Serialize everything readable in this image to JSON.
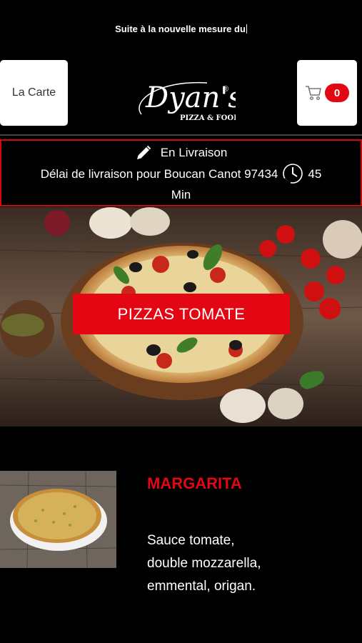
{
  "ticker": {
    "text": "Suite à la nouvelle mesure du"
  },
  "header": {
    "menu_label": "La Carte",
    "cart_count": "0",
    "logo": {
      "name": "Dyan's",
      "tagline": "PIZZA & FOOD",
      "mark": "®"
    }
  },
  "delivery": {
    "mode": "En Livraison",
    "delay_text": "Délai de livraison pour Boucan Canot 97434",
    "delay_value": "45",
    "delay_unit": "Min"
  },
  "hero": {
    "category_label": "PIZZAS TOMATE"
  },
  "product": {
    "name": "MARGARITA",
    "description_lines": [
      "Sauce tomate,",
      "double mozzarella,",
      "emmental, origan."
    ]
  },
  "colors": {
    "accent": "#e30613",
    "background": "#000000",
    "border": "#d20a0a"
  },
  "icons": {
    "cart": "cart-icon",
    "edit": "pencil-icon",
    "clock": "clock-icon"
  }
}
